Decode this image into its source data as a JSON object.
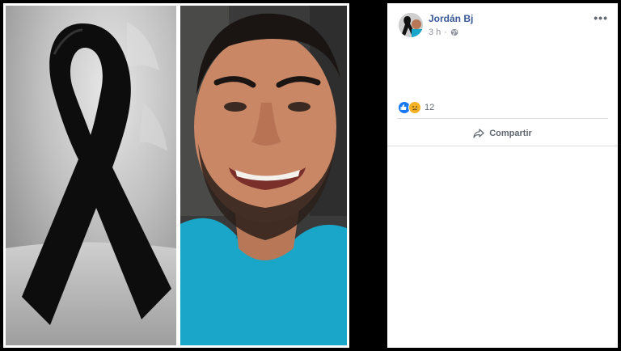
{
  "post": {
    "author": "Jordán Bj",
    "timestamp": "3 h",
    "privacy_icon": "globe-icon",
    "more_label": "•••",
    "reactions": {
      "types": [
        "like",
        "sad"
      ],
      "count": "12"
    },
    "share_label": "Compartir"
  },
  "colors": {
    "author_link": "#385898",
    "like_blue": "#1877f2",
    "sad_yellow": "#f7b125",
    "meta_gray": "#90949c"
  }
}
